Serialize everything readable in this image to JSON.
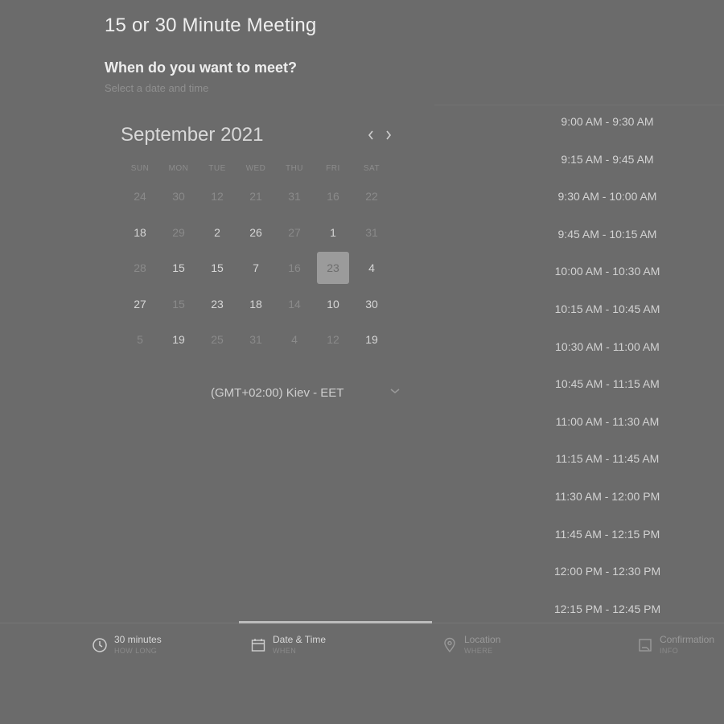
{
  "page": {
    "title": "15 or 30 Minute Meeting",
    "question": "When do you want to meet?",
    "subquestion": "Select a date and time"
  },
  "calendar": {
    "month_label": "September 2021",
    "prev_icon": "chevron-left-icon",
    "next_icon": "chevron-right-icon",
    "weekdays": [
      "SUN",
      "MON",
      "TUE",
      "WED",
      "THU",
      "FRI",
      "SAT"
    ],
    "weeks": [
      [
        "24",
        "30",
        "12",
        "21",
        "31",
        "16",
        "22"
      ],
      [
        "18",
        "29",
        "2",
        "26",
        "27",
        "1",
        "31"
      ],
      [
        "28",
        "15",
        "15",
        "7",
        "16",
        "23",
        "4"
      ],
      [
        "27",
        "15",
        "23",
        "18",
        "14",
        "10",
        "30"
      ],
      [
        "5",
        "19",
        "25",
        "31",
        "4",
        "12",
        "19"
      ]
    ],
    "selected_day": "23"
  },
  "timezone": {
    "label": "(GMT+02:00) Kiev - EET",
    "icon": "chevron-down-icon"
  },
  "time_slots": [
    "9:00 AM - 9:30 AM",
    "9:15 AM - 9:45 AM",
    "9:30 AM - 10:00 AM",
    "9:45 AM - 10:15 AM",
    "10:00 AM - 10:30 AM",
    "10:15 AM - 10:45 AM",
    "10:30 AM - 11:00 AM",
    "10:45 AM - 11:15 AM",
    "11:00 AM - 11:30 AM",
    "11:15 AM - 11:45 AM",
    "11:30 AM - 12:00 PM",
    "11:45 AM - 12:15 PM",
    "12:00 PM - 12:30 PM",
    "12:15 PM - 12:45 PM"
  ],
  "steps": [
    {
      "title": "30 minutes",
      "subtitle": "HOW LONG",
      "icon": "clock-icon"
    },
    {
      "title": "Date & Time",
      "subtitle": "WHEN",
      "icon": "calendar-icon"
    },
    {
      "title": "Location",
      "subtitle": "WHERE",
      "icon": "location-pin-icon"
    },
    {
      "title": "Confirmation",
      "subtitle": "INFO",
      "icon": "document-icon"
    }
  ],
  "colors": {
    "background": "#6b6b6b",
    "selected_day_bg": "#9b9b9b",
    "active_step_bar": "#bcbcbc"
  }
}
